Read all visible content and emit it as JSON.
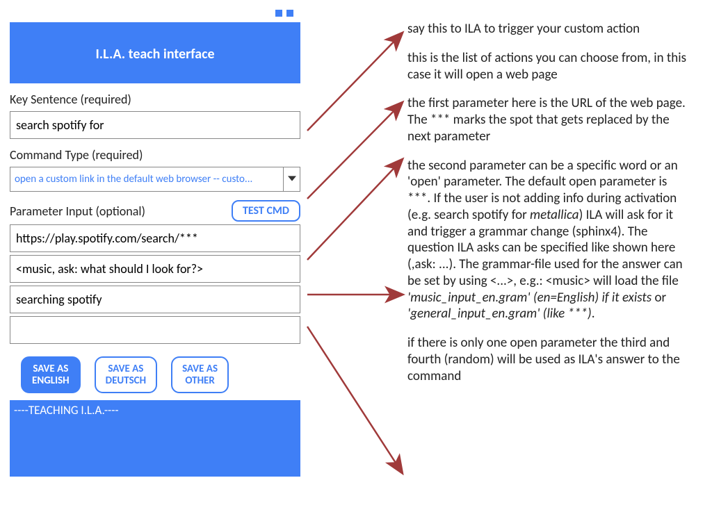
{
  "header": {
    "title": "I.L.A. teach interface"
  },
  "labels": {
    "key_sentence": "Key Sentence (required)",
    "command_type": "Command Type (required)",
    "parameter_input": "Parameter Input (optional)"
  },
  "fields": {
    "key_sentence": "search spotify for",
    "command_type_selected": "open a custom link in the default web browser -- custo...",
    "param1": "https://play.spotify.com/search/***",
    "param2": "<music, ask: what should I look for?>",
    "param3": "searching spotify",
    "param4": ""
  },
  "buttons": {
    "test_cmd": "TEST CMD",
    "save_en": "SAVE AS\nENGLISH",
    "save_de": "SAVE AS\nDEUTSCH",
    "save_other": "SAVE AS\nOTHER"
  },
  "console": {
    "text": "----TEACHING I.L.A.----"
  },
  "annotations": {
    "a1": "say this to ILA to trigger your custom action",
    "a2": "this is the list of actions you can choose from, in this case it will open a web page",
    "a3": "the first parameter here is the URL of the web page. The *** marks the spot that gets replaced by the next parameter",
    "a4_pre": "the second parameter can be a specific word or an 'open' parameter. The default open parameter is ***. If the user is not adding info during activation (e.g. search spotify for ",
    "a4_it1": "metallica",
    "a4_mid": ") ILA will ask for it and trigger a grammar change (sphinx4). The question ILA asks can be specified like shown here (,ask: ...). The grammar-file used for the answer can be set by using <...>, e.g.: <music> will load the file ",
    "a4_it2": "'music_input_en.gram' (en=English) if it exists",
    "a4_mid2": " or ",
    "a4_it3": "'general_input_en.gram' (like ***)",
    "a4_post": ".",
    "a5": "if there is only one open parameter the third and fourth (random) will be used as ILA's answer to the command"
  }
}
